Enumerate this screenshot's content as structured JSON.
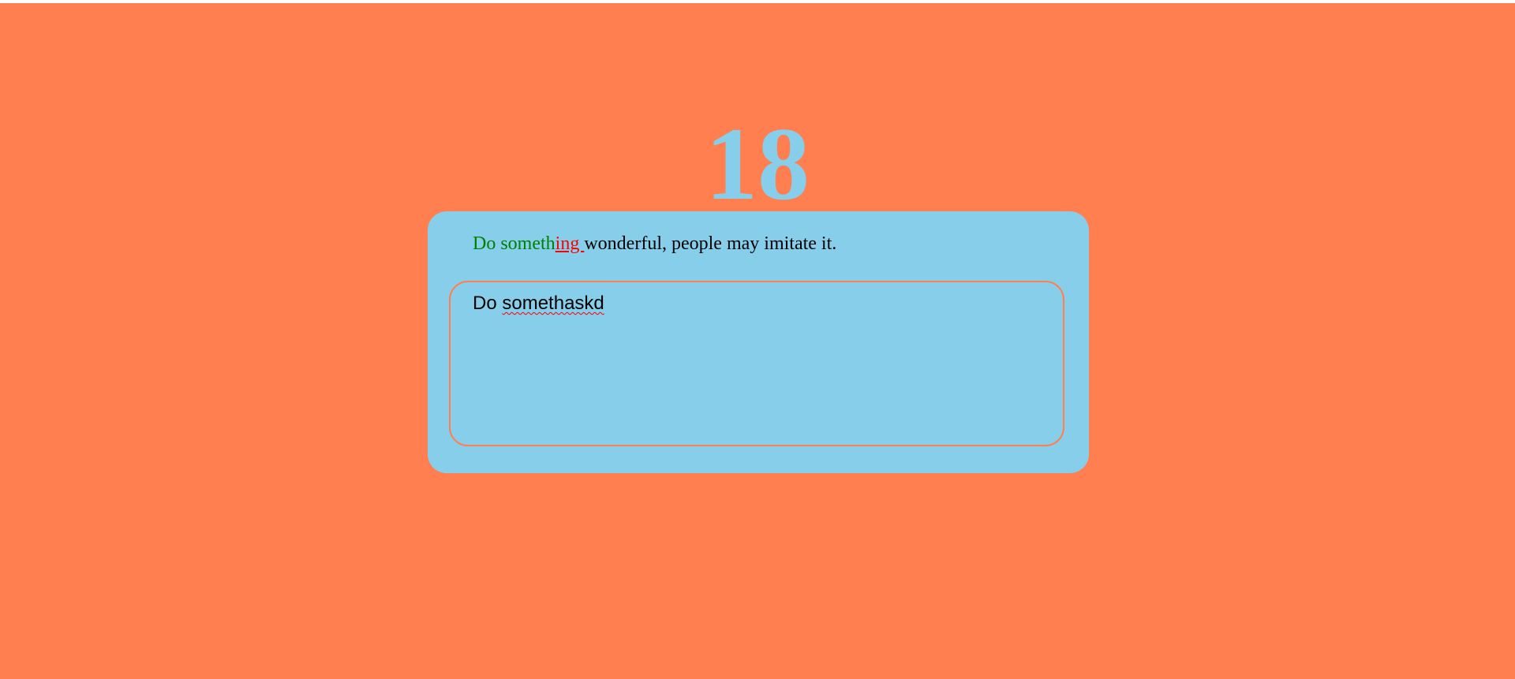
{
  "timer": {
    "value": "18"
  },
  "quote": {
    "correct": "Do someth",
    "incorrect": "ing ",
    "remaining": "wonderful, people may imitate it."
  },
  "input": {
    "first_word": "Do ",
    "misspelled_word": "somethaskd"
  },
  "colors": {
    "background": "#ff7f50",
    "card": "#87ceeb",
    "correct": "#008000",
    "incorrect": "#ff0000"
  }
}
